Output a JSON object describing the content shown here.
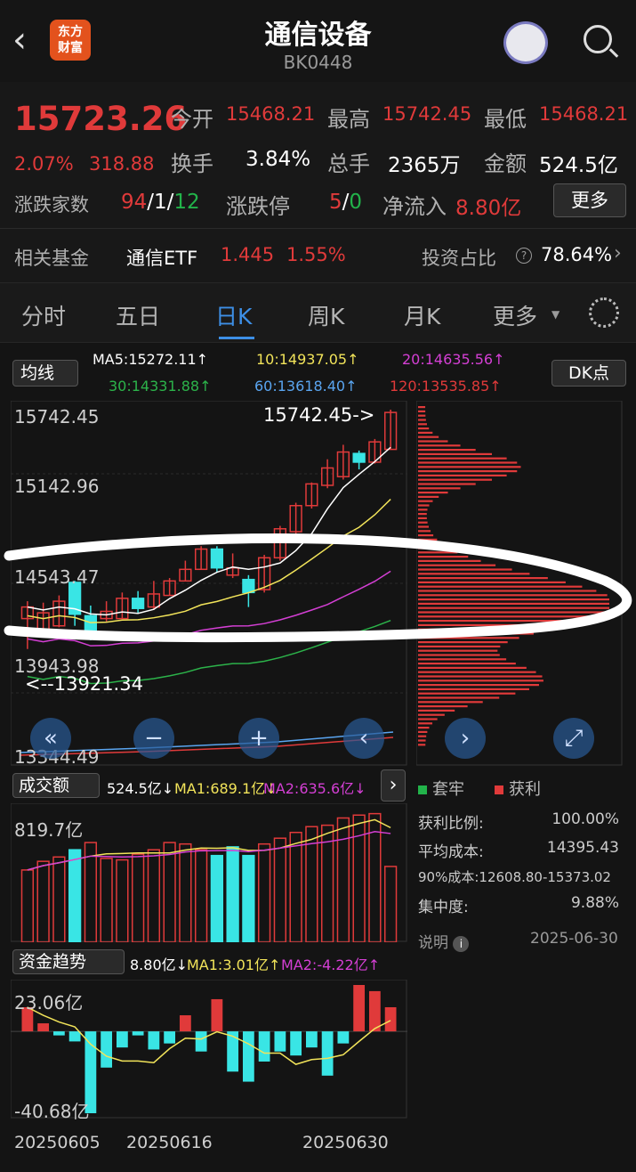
{
  "header": {
    "title": "通信设备",
    "code": "BK0448",
    "logo_text": "东方\n财富"
  },
  "quote": {
    "price": "15723.26",
    "pct": "2.07%",
    "change": "318.88",
    "open_label": "今开",
    "open": "15468.21",
    "high_label": "最高",
    "high": "15742.45",
    "low_label": "最低",
    "low": "15468.21",
    "turnover_label": "换手",
    "turnover": "3.84%",
    "volume_label": "总手",
    "volume": "2365万",
    "amount_label": "金额",
    "amount": "524.5亿",
    "breadth_label": "涨跌家数",
    "up": "94",
    "flat": "1",
    "down": "12",
    "limit_label": "涨跌停",
    "limit_up": "5",
    "limit_down": "0",
    "inflow_label": "净流入",
    "inflow": "8.80亿",
    "more": "更多",
    "fund_label": "相关基金",
    "fund_name": "通信ETF",
    "fund_price": "1.445",
    "fund_pct": "1.55%",
    "ratio_label": "投资占比",
    "ratio": "78.64%"
  },
  "tabs": [
    "分时",
    "五日",
    "日K",
    "周K",
    "月K",
    "更多"
  ],
  "ma": {
    "selector": "均线",
    "ma5": "MA5:15272.11↑",
    "ma10": "10:14937.05↑",
    "ma20": "20:14635.56↑",
    "ma30": "30:14331.88↑",
    "ma60": "60:13618.40↑",
    "ma120": "120:13535.85↑",
    "dk": "DK点"
  },
  "kline": {
    "y1": "15742.45",
    "y2": "15142.96",
    "y3": "14543.47",
    "y4": "13943.98",
    "y5": "13344.49",
    "max_note": "15742.45->",
    "min_note": "<--13921.34"
  },
  "vol": {
    "label": "成交额",
    "v": "524.5亿↓",
    "ma1": "MA1:689.1亿↓",
    "ma2": "MA2:635.6亿↓",
    "top": "819.7亿"
  },
  "flow": {
    "label": "资金趋势",
    "v": "8.80亿↓",
    "ma1": "MA1:3.01亿↑",
    "ma2": "MA2:-4.22亿↑",
    "top": "23.06亿",
    "bottom": "-40.68亿"
  },
  "dates": [
    "20250605",
    "20250616",
    "20250630"
  ],
  "chips": {
    "legend_trap": "套牢",
    "legend_profit": "获利",
    "profit_label": "获利比例:",
    "profit": "100.00%",
    "avg_label": "平均成本:",
    "avg": "14395.43",
    "c90_label": "90%成本:",
    "c90": "12608.80-15373.02",
    "conc_label": "集中度:",
    "conc": "9.88%",
    "note": "说明",
    "date": "2025-06-30"
  },
  "chart_data": {
    "type": "candlestick",
    "ylim": [
      13344.49,
      15742.45
    ],
    "candles": [
      [
        14300,
        14380,
        14090,
        14420
      ],
      [
        14200,
        14340,
        14180,
        14410
      ],
      [
        14250,
        14420,
        14240,
        14460
      ],
      [
        14550,
        14330,
        14250,
        14560
      ],
      [
        14320,
        14190,
        14150,
        14390
      ],
      [
        14300,
        14350,
        14280,
        14420
      ],
      [
        14300,
        14440,
        14300,
        14480
      ],
      [
        14440,
        14370,
        14340,
        14490
      ],
      [
        14380,
        14470,
        14360,
        14560
      ],
      [
        14460,
        14560,
        14460,
        14580
      ],
      [
        14560,
        14640,
        14560,
        14700
      ],
      [
        14640,
        14780,
        14640,
        14800
      ],
      [
        14780,
        14650,
        14620,
        14800
      ],
      [
        14600,
        14650,
        14580,
        14750
      ],
      [
        14570,
        14480,
        14380,
        14600
      ],
      [
        14500,
        14720,
        14480,
        14740
      ],
      [
        14720,
        14920,
        14700,
        14940
      ],
      [
        14900,
        15080,
        14880,
        15100
      ],
      [
        15080,
        15230,
        15060,
        15240
      ],
      [
        15220,
        15340,
        15200,
        15400
      ],
      [
        15280,
        15450,
        15260,
        15500
      ],
      [
        15440,
        15380,
        15330,
        15460
      ],
      [
        15380,
        15520,
        15370,
        15540
      ],
      [
        15468.21,
        15723.26,
        15468.21,
        15742.45
      ]
    ],
    "volume": [
      500,
      560,
      590,
      640,
      690,
      580,
      570,
      610,
      640,
      690,
      680,
      640,
      600,
      660,
      600,
      680,
      720,
      760,
      800,
      810,
      860,
      880,
      890,
      524.5
    ],
    "volume_bear": [
      false,
      false,
      false,
      true,
      false,
      false,
      false,
      false,
      false,
      false,
      false,
      false,
      true,
      true,
      true,
      false,
      false,
      false,
      false,
      false,
      false,
      false,
      false,
      false
    ],
    "flow": [
      12,
      4,
      -2,
      -5,
      -40.68,
      -18,
      -8,
      -2,
      -9,
      -6,
      8,
      -10,
      16,
      -20,
      -25,
      -15,
      -10,
      -12,
      -8,
      -22,
      -6,
      23.06,
      20,
      12
    ]
  }
}
